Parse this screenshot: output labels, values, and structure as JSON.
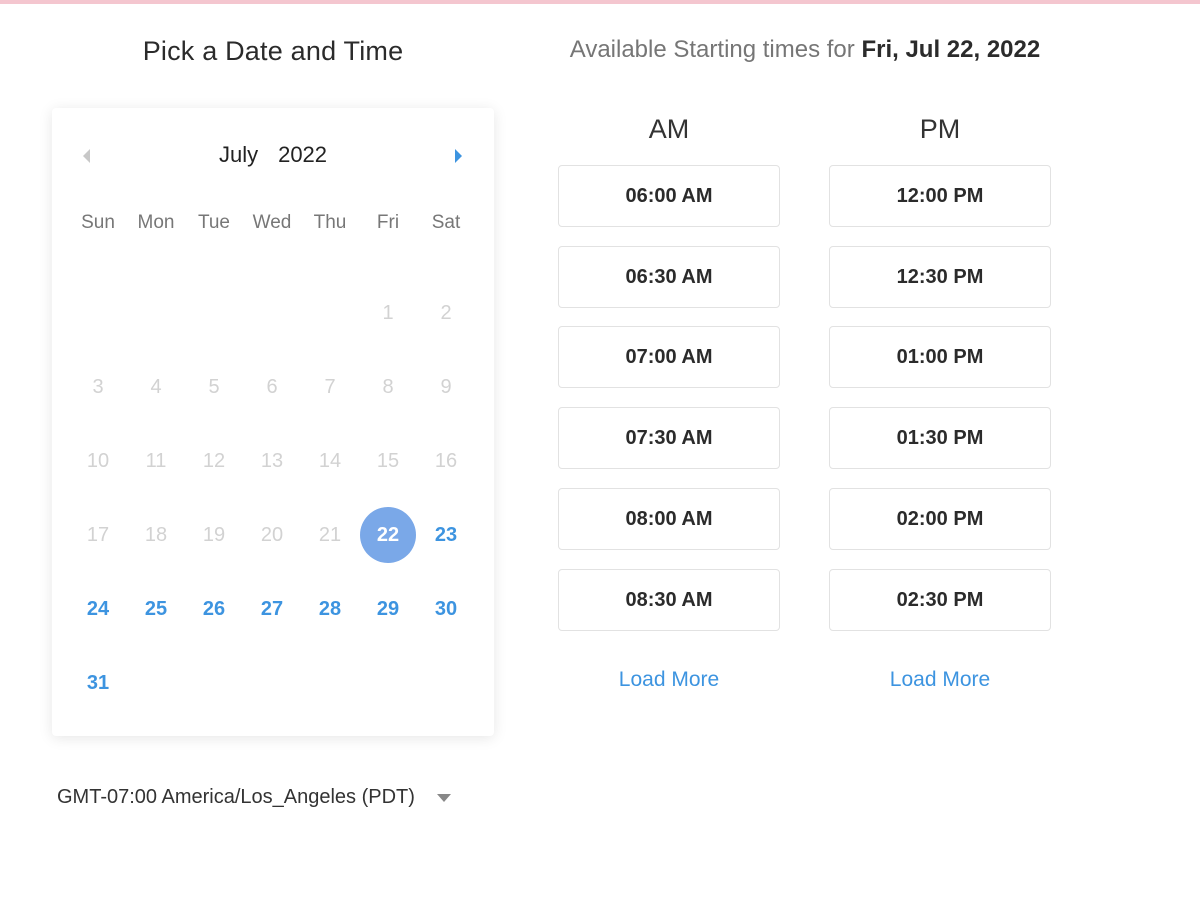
{
  "page_title": "Pick a Date and Time",
  "available": {
    "prefix": "Available Starting times for",
    "date": "Fri, Jul 22, 2022"
  },
  "calendar": {
    "month": "July",
    "year": "2022",
    "weekdays": [
      "Sun",
      "Mon",
      "Tue",
      "Wed",
      "Thu",
      "Fri",
      "Sat"
    ],
    "weeks": [
      [
        "",
        "",
        "",
        "",
        "",
        "1",
        "2"
      ],
      [
        "3",
        "4",
        "5",
        "6",
        "7",
        "8",
        "9"
      ],
      [
        "10",
        "11",
        "12",
        "13",
        "14",
        "15",
        "16"
      ],
      [
        "17",
        "18",
        "19",
        "20",
        "21",
        "22",
        "23"
      ],
      [
        "24",
        "25",
        "26",
        "27",
        "28",
        "29",
        "30"
      ],
      [
        "31",
        "",
        "",
        "",
        "",
        "",
        ""
      ]
    ],
    "selected_day": "22",
    "available_days": [
      "23",
      "24",
      "25",
      "26",
      "27",
      "28",
      "29",
      "30",
      "31"
    ]
  },
  "timezone": "GMT-07:00 America/Los_Angeles (PDT)",
  "am": {
    "label": "AM",
    "slots": [
      "06:00 AM",
      "06:30 AM",
      "07:00 AM",
      "07:30 AM",
      "08:00 AM",
      "08:30 AM"
    ],
    "load_more": "Load More"
  },
  "pm": {
    "label": "PM",
    "slots": [
      "12:00 PM",
      "12:30 PM",
      "01:00 PM",
      "01:30 PM",
      "02:00 PM",
      "02:30 PM"
    ],
    "load_more": "Load More"
  },
  "colors": {
    "accent": "#3d94e0",
    "selected": "#7aa8e8",
    "disabled": "#d2d2d2"
  }
}
